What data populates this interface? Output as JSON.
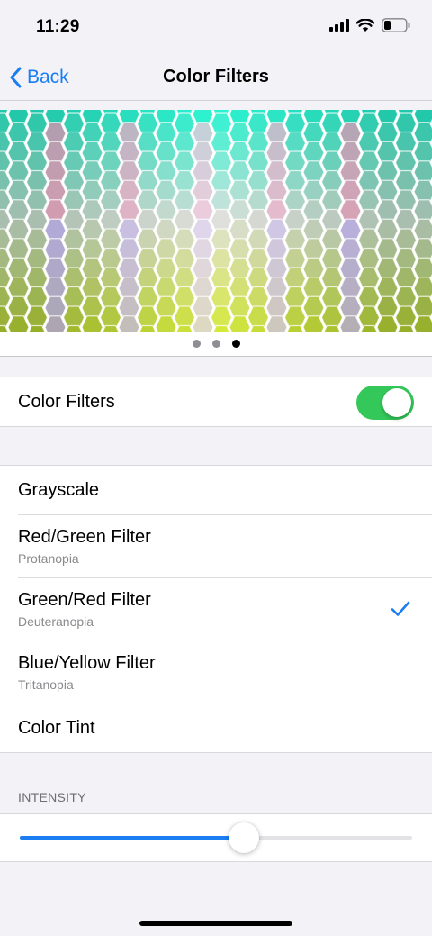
{
  "status": {
    "time": "11:29"
  },
  "nav": {
    "back_label": "Back",
    "title": "Color Filters"
  },
  "preview": {
    "pages": 3,
    "active_page": 3
  },
  "toggle_row": {
    "label": "Color Filters",
    "on": true
  },
  "filters": [
    {
      "label": "Grayscale",
      "sub": "",
      "selected": false
    },
    {
      "label": "Red/Green Filter",
      "sub": "Protanopia",
      "selected": false
    },
    {
      "label": "Green/Red Filter",
      "sub": "Deuteranopia",
      "selected": true
    },
    {
      "label": "Blue/Yellow Filter",
      "sub": "Tritanopia",
      "selected": false
    },
    {
      "label": "Color Tint",
      "sub": "",
      "selected": false
    }
  ],
  "intensity": {
    "header": "INTENSITY",
    "value": 0.57
  },
  "colors": {
    "accent": "#1a7ef2",
    "toggle_on": "#34c759"
  }
}
